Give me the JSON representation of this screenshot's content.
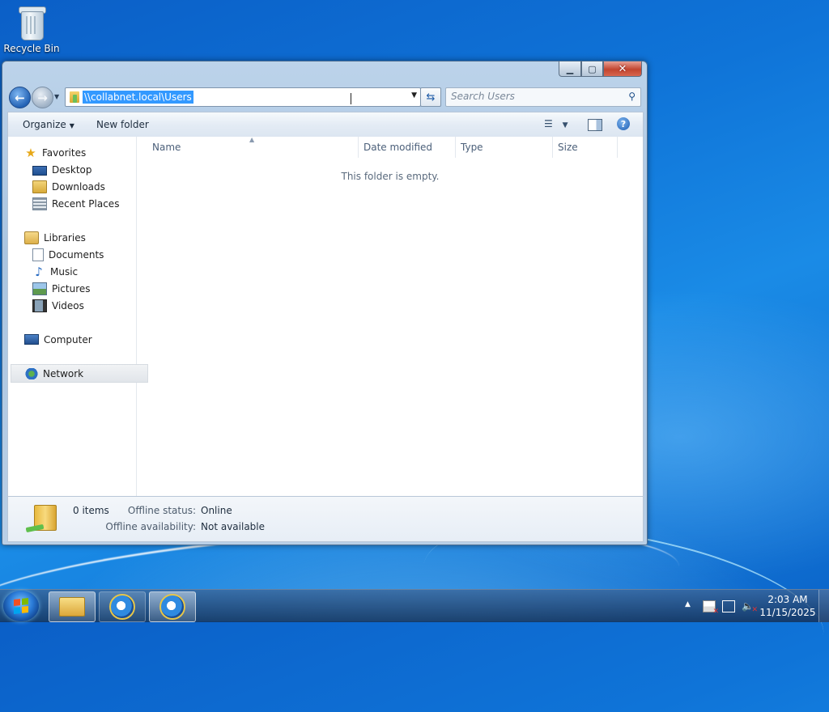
{
  "desktop": {
    "recycle_bin_label": "Recycle Bin"
  },
  "window": {
    "address": "\\\\collabnet.local\\Users",
    "search_placeholder": "Search Users",
    "toolbar": {
      "organize": "Organize",
      "new_folder": "New folder"
    },
    "nav": {
      "favorites": "Favorites",
      "desktop": "Desktop",
      "downloads": "Downloads",
      "recent_places": "Recent Places",
      "libraries": "Libraries",
      "documents": "Documents",
      "music": "Music",
      "pictures": "Pictures",
      "videos": "Videos",
      "computer": "Computer",
      "network": "Network"
    },
    "columns": {
      "name": "Name",
      "date_modified": "Date modified",
      "type": "Type",
      "size": "Size"
    },
    "empty_message": "This folder is empty.",
    "details": {
      "count": "0 items",
      "offline_status_label": "Offline status:",
      "offline_status_value": "Online",
      "offline_availability_label": "Offline availability:",
      "offline_availability_value": "Not available"
    }
  },
  "taskbar": {
    "time": "2:03 AM",
    "date": "11/15/2025"
  },
  "icons": {
    "favorites": "star-icon",
    "desktop": "desktop-icon",
    "downloads": "downloads-folder-icon",
    "recent_places": "recent-places-icon",
    "libraries": "libraries-icon",
    "documents": "document-icon",
    "music": "music-note-icon",
    "pictures": "pictures-icon",
    "videos": "video-film-icon",
    "computer": "computer-icon",
    "network": "network-globe-icon"
  },
  "colors": {
    "selection": "#3399ff",
    "close_button": "#c2452f",
    "desktop_blue": "#0f74d8"
  }
}
